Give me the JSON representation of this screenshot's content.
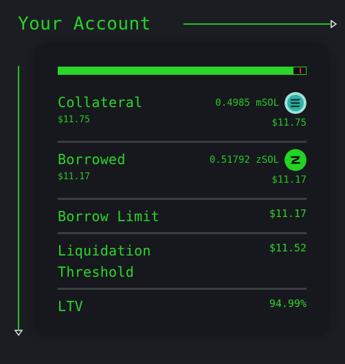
{
  "header": {
    "title": "Your Account"
  },
  "ltv_bar": {
    "fill_fraction": 0.95,
    "marker_fraction": 0.98
  },
  "collateral": {
    "label": "Collateral",
    "usd": "$11.75",
    "amount": "0.4985 mSOL",
    "amount_usd": "$11.75",
    "icon": "msol-token-icon"
  },
  "borrowed": {
    "label": "Borrowed",
    "usd": "$11.17",
    "amount": "0.51792 zSOL",
    "amount_usd": "$11.17",
    "icon": "zsol-token-icon"
  },
  "borrow_limit": {
    "label": "Borrow Limit",
    "value": "$11.17"
  },
  "liquidation": {
    "label_line1": "Liquidation",
    "label_line2": "Threshold",
    "value": "$11.52"
  },
  "ltv": {
    "label": "LTV",
    "value": "94.99%"
  },
  "colors": {
    "accent": "#2bd62b",
    "background": "#1c1d23",
    "card": "#17181d",
    "warning": "#e02a2a"
  }
}
